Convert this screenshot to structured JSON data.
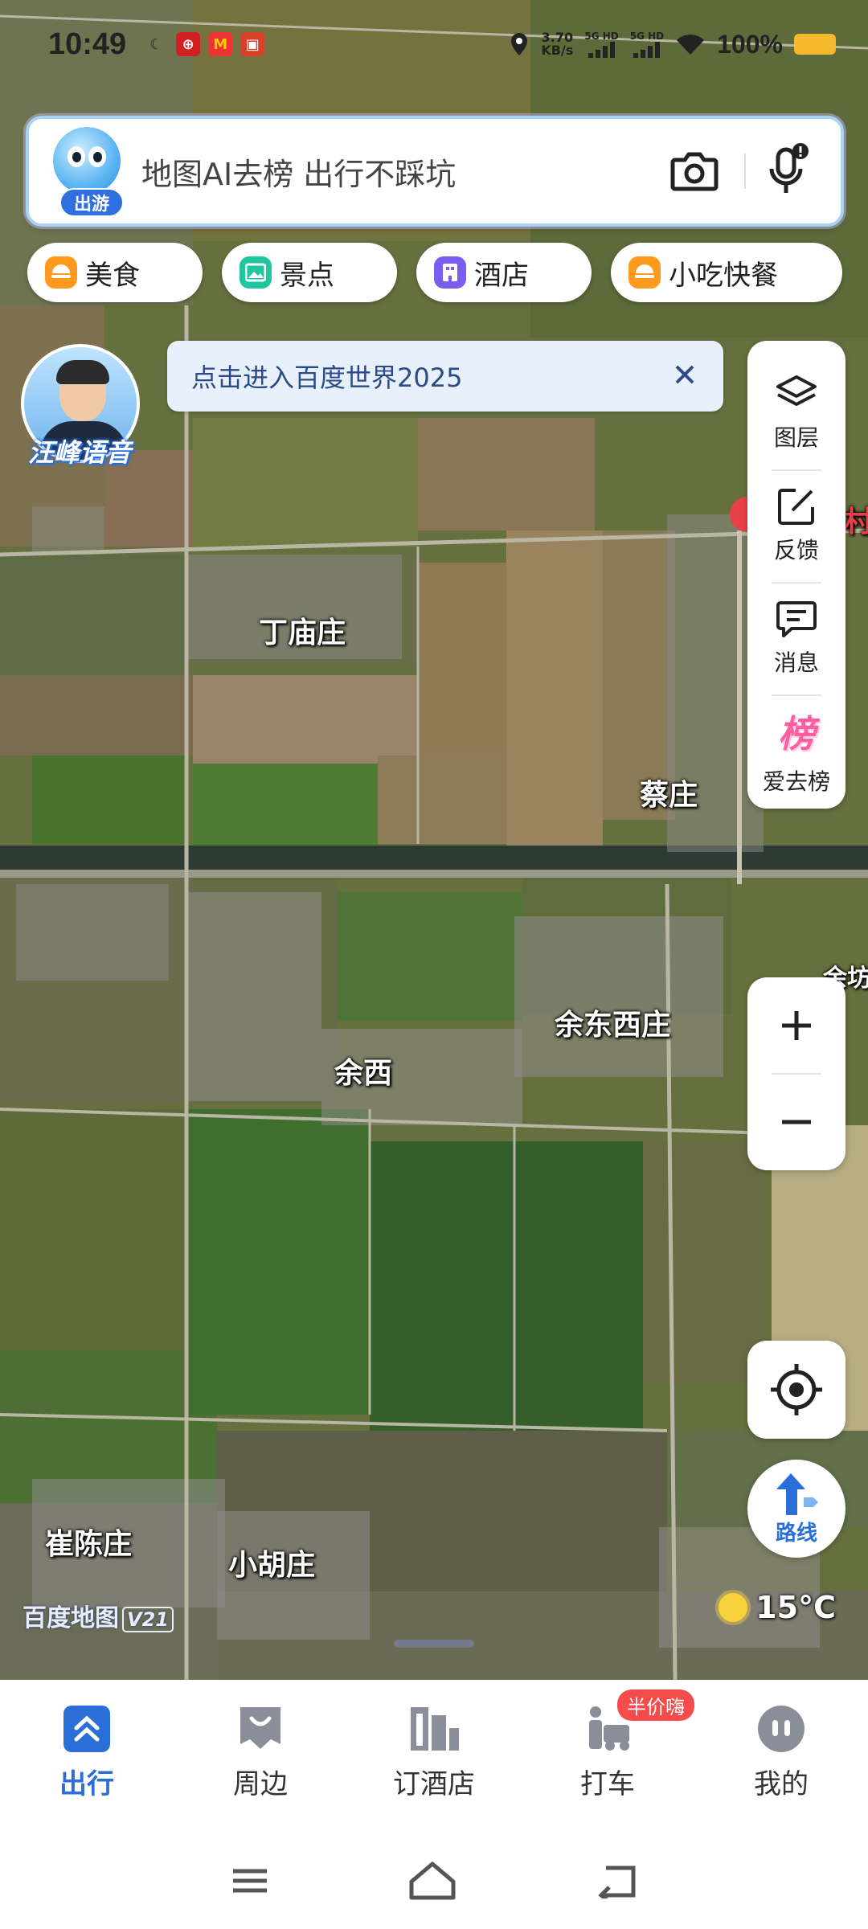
{
  "status_bar": {
    "time": "10:49",
    "network_speed_value": "3.70",
    "network_speed_unit": "KB/s",
    "signal_1": "5G HD",
    "signal_2": "5G HD",
    "battery": "100%"
  },
  "search": {
    "mascot_tag": "出游",
    "placeholder": "地图AI去榜 出行不踩坑",
    "camera_icon": "camera-icon",
    "mic_icon": "microphone-icon"
  },
  "categories": [
    {
      "label": "美食",
      "color": "#ff9a1f"
    },
    {
      "label": "景点",
      "color": "#1fc6a0"
    },
    {
      "label": "酒店",
      "color": "#7a5cf0"
    },
    {
      "label": "小吃快餐",
      "color": "#ff9a1f"
    }
  ],
  "voice": {
    "label": "汪峰语音"
  },
  "banner": {
    "text": "点击进入百度世界2025"
  },
  "tools": [
    {
      "label": "图层",
      "icon": "layers-icon"
    },
    {
      "label": "反馈",
      "icon": "feedback-icon"
    },
    {
      "label": "消息",
      "icon": "message-icon"
    },
    {
      "label": "爱去榜",
      "icon": "ranking-icon",
      "glyph": "榜"
    }
  ],
  "map": {
    "labels": [
      "丁庙庄",
      "蔡庄",
      "余东西庄",
      "余西",
      "崔陈庄",
      "小胡庄",
      "村",
      "余坊"
    ],
    "watermark": "百度地图",
    "watermark_version": "V21",
    "temperature": "15°C"
  },
  "route": {
    "label": "路线"
  },
  "tabs": [
    {
      "label": "出行",
      "icon": "travel-icon",
      "active": true
    },
    {
      "label": "周边",
      "icon": "nearby-icon",
      "active": false
    },
    {
      "label": "订酒店",
      "icon": "hotel-icon",
      "active": false
    },
    {
      "label": "打车",
      "icon": "taxi-icon",
      "active": false,
      "badge": "半价嗨"
    },
    {
      "label": "我的",
      "icon": "profile-icon",
      "active": false
    }
  ],
  "colors": {
    "accent": "#2a6fd8",
    "badge": "#f54b4b"
  }
}
